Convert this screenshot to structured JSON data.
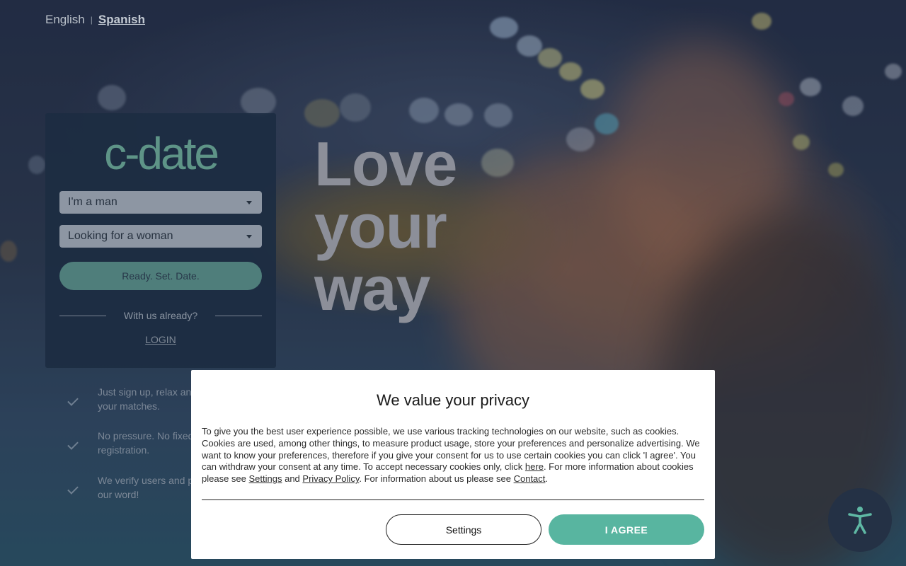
{
  "language": {
    "english_label": "English",
    "separator": "|",
    "spanish_label": "Spanish"
  },
  "signup": {
    "logo_text": "c-date",
    "gender_select": "I'm a man",
    "seeking_select": "Looking for a woman",
    "cta_label": "Ready. Set. Date.",
    "existing_user_text": "With us already?",
    "login_label": "LOGIN"
  },
  "headline": {
    "line1": "Love",
    "line2": "your",
    "line3": "way"
  },
  "features": [
    {
      "text": "Just sign up, relax and\nyour matches."
    },
    {
      "text": "No pressure. No fixed\nregistration."
    },
    {
      "text": "We verify users and p\nour word!"
    }
  ],
  "privacy": {
    "title": "We value your privacy",
    "text_1": "To give you the best user experience possible, we use various tracking technologies on our website, such as cookies. Cookies are used, among other things, to measure product usage, store your preferences and personalize advertising. We want to know your preferences, therefore if you give your consent for us to use certain cookies you can click 'I agree'. You can withdraw your consent at any time. To accept necessary cookies only, click ",
    "link_here": "here",
    "text_2": ". For more information about cookies please see ",
    "link_settings": "Settings",
    "text_3": " and ",
    "link_privacy": "Privacy Policy",
    "text_4": ". For information about us please see ",
    "link_contact": "Contact",
    "text_5": ".",
    "settings_button": "Settings",
    "agree_button": "I AGREE"
  },
  "colors": {
    "accent_teal": "#58b5a0",
    "card_bg": "#1c2c42",
    "accessibility_button_bg": "#243145"
  },
  "icons": {
    "accessibility": "accessibility-person-icon",
    "feature_check": "check-icon",
    "select_caret": "caret-down-icon"
  }
}
